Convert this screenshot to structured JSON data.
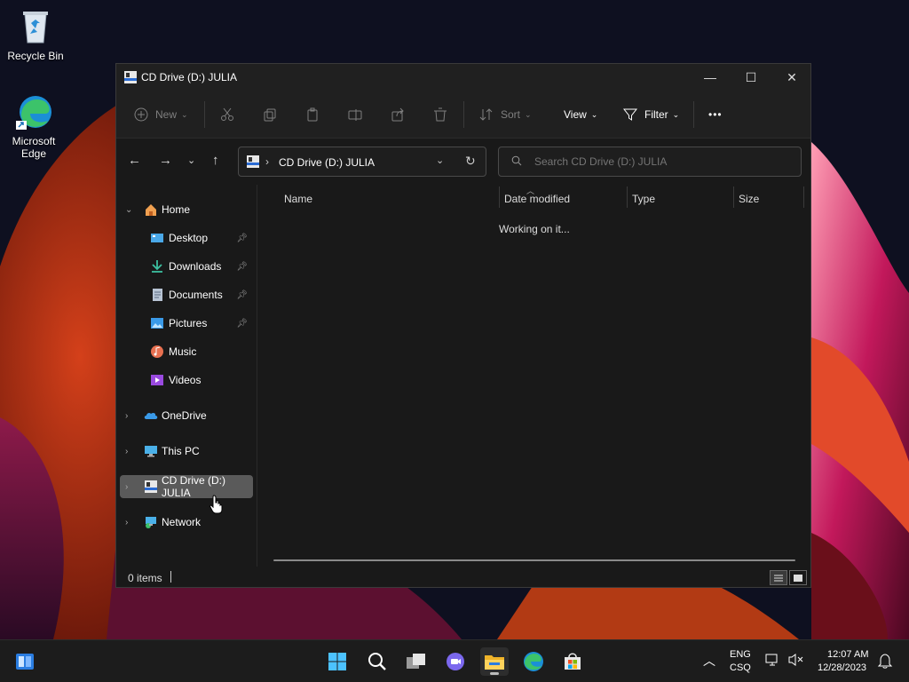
{
  "desktop": {
    "icons": [
      {
        "label": "Recycle Bin",
        "icon": "recycle-bin-icon"
      },
      {
        "label": "Microsoft Edge",
        "icon": "edge-icon"
      }
    ]
  },
  "window": {
    "title": "CD Drive (D:) JULIA",
    "controls": {
      "minimize": "—",
      "maximize": "☐",
      "close": "✕"
    }
  },
  "toolbar": {
    "new_label": "New",
    "sort_label": "Sort",
    "view_label": "View",
    "filter_label": "Filter",
    "more_label": "•••"
  },
  "address": {
    "path": "CD Drive (D:) JULIA",
    "search_placeholder": "Search CD Drive (D:) JULIA"
  },
  "navpane": {
    "items": [
      {
        "label": "Home",
        "icon": "home-icon"
      },
      {
        "label": "Desktop",
        "icon": "desktop-icon"
      },
      {
        "label": "Downloads",
        "icon": "download-icon"
      },
      {
        "label": "Documents",
        "icon": "documents-icon"
      },
      {
        "label": "Pictures",
        "icon": "pictures-icon"
      },
      {
        "label": "Music",
        "icon": "music-icon"
      },
      {
        "label": "Videos",
        "icon": "videos-icon"
      },
      {
        "label": "OneDrive",
        "icon": "onedrive-icon"
      },
      {
        "label": "This PC",
        "icon": "this-pc-icon"
      },
      {
        "label": "CD Drive (D:) JULIA",
        "icon": "cd-drive-icon"
      },
      {
        "label": "Network",
        "icon": "network-icon"
      }
    ]
  },
  "content": {
    "columns": [
      "Name",
      "Date modified",
      "Type",
      "Size"
    ],
    "status_message": "Working on it..."
  },
  "statusbar": {
    "item_count": "0 items"
  },
  "taskbar": {
    "language": "ENG",
    "input_method": "CSQ",
    "time": "12:07 AM",
    "date": "12/28/2023"
  },
  "colors": {
    "accent": "#60cdff",
    "window_bg": "#191919",
    "selection": "#5a5a5a"
  }
}
